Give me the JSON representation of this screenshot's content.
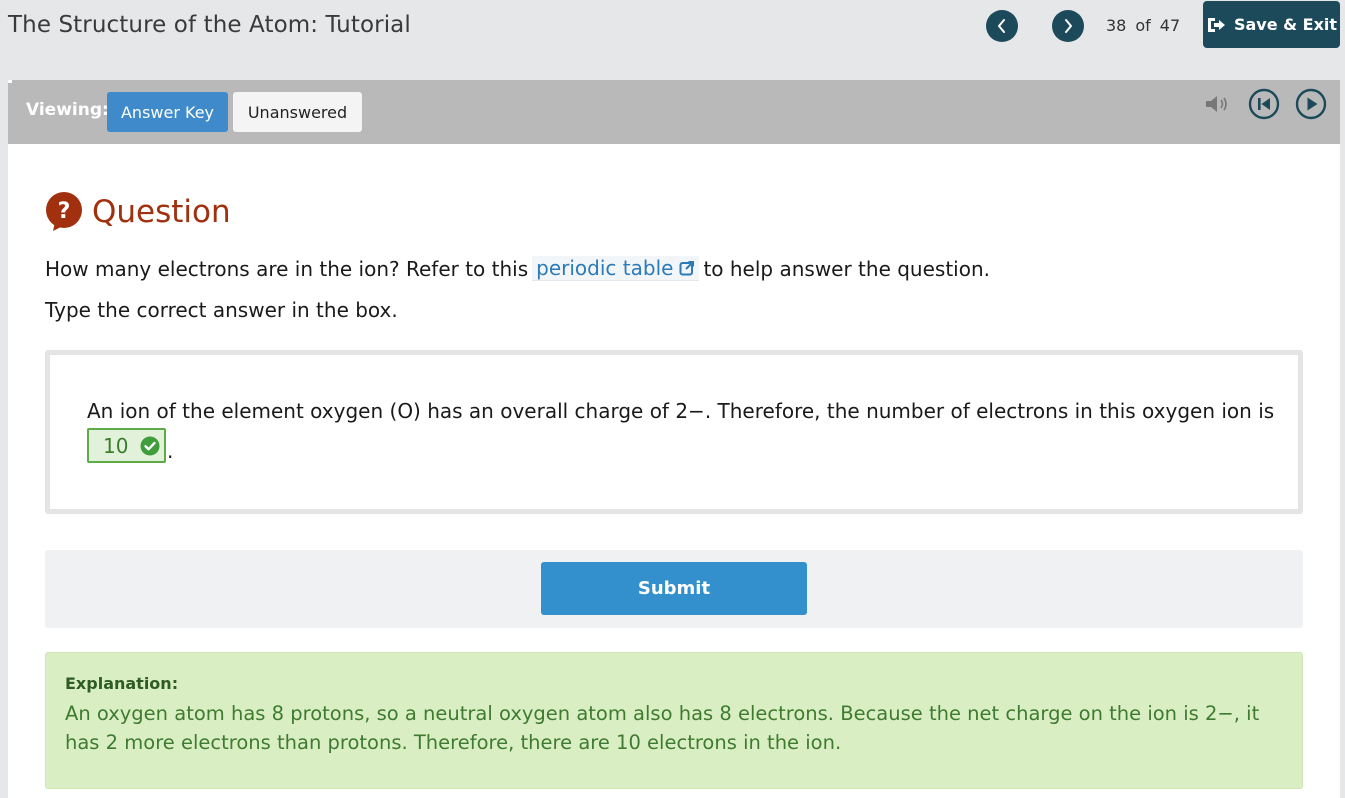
{
  "header": {
    "title": "The Structure of the Atom: Tutorial",
    "page_current": "38",
    "page_of": "of",
    "page_total": "47",
    "save_exit_label": "Save & Exit"
  },
  "toolbar": {
    "viewing_label": "Viewing:",
    "tabs": [
      {
        "label": "Answer Key",
        "active": true
      },
      {
        "label": "Unanswered",
        "active": false
      }
    ]
  },
  "question": {
    "heading": "Question",
    "prompt_before_link": "How many electrons are in the ion? Refer to this",
    "link_text": "periodic table",
    "prompt_after_link": "to help answer the question.",
    "instruction": "Type the correct answer in the box.",
    "sentence": "An ion of the element oxygen (O) has an overall charge of 2−. Therefore, the number of electrons in this oxygen ion is",
    "answer_value": "10",
    "answer_status": "correct",
    "trailing": "."
  },
  "submit_label": "Submit",
  "explanation": {
    "label": "Explanation:",
    "text": "An oxygen atom has 8 protons, so a neutral oxygen atom also has 8 electrons. Because the net charge on the ion is 2−, it has 2 more electrons than protons. Therefore, there are 10 electrons in the ion."
  },
  "colors": {
    "header_dark": "#1d4a5b",
    "question_accent": "#a0300e",
    "tab_active": "#3e8acb",
    "submit": "#3490cc",
    "correct_green": "#5cab47",
    "explanation_bg": "#d9efc3"
  },
  "icons": {
    "prev": "chevron-left-icon",
    "next": "chevron-right-icon",
    "exit": "exit-icon",
    "audio": "speaker-icon",
    "rewind": "rewind-icon",
    "play": "play-icon",
    "question": "question-bubble-icon",
    "external": "external-link-icon",
    "check": "check-circle-icon"
  }
}
